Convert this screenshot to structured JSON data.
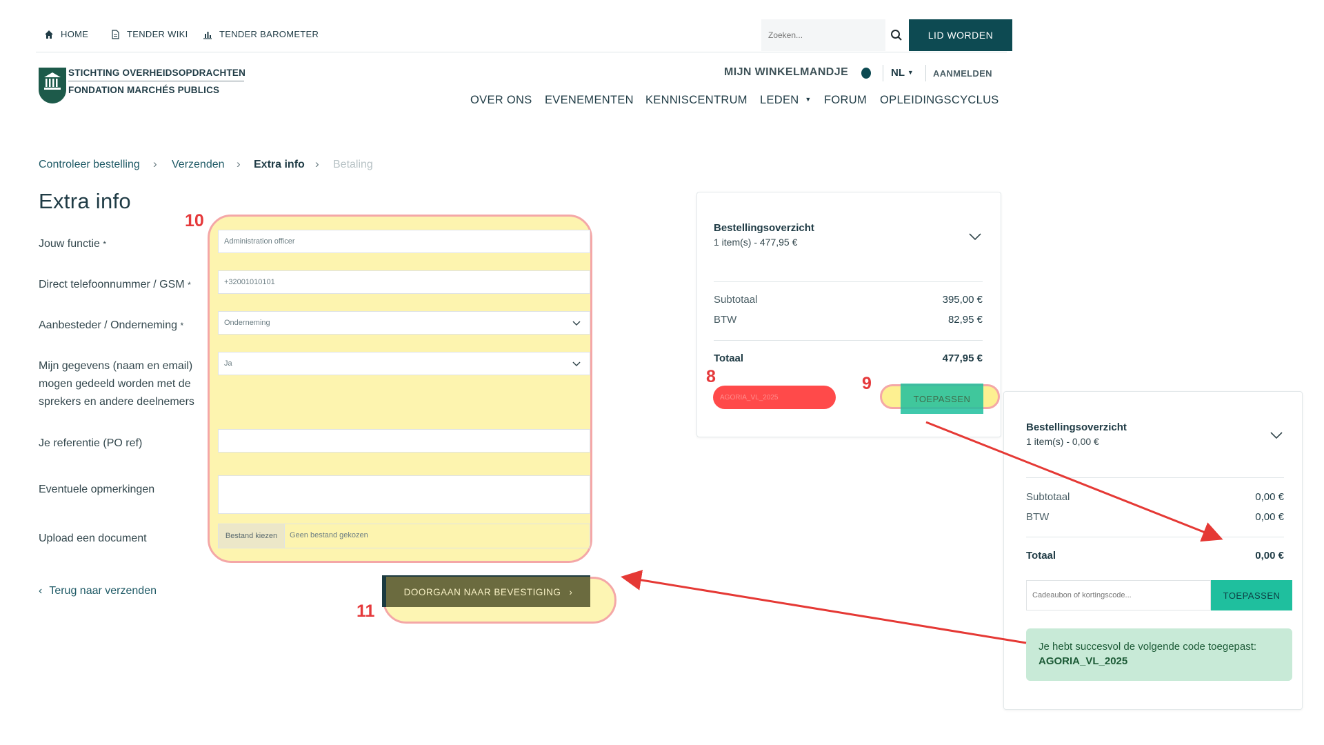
{
  "topbar": {
    "home": "HOME",
    "wiki": "TENDER WIKI",
    "barometer": "TENDER BAROMETER",
    "search_placeholder": "Zoeken...",
    "lid_worden": "LID WORDEN"
  },
  "logo": {
    "line1": "STICHTING OVERHEIDSOPDRACHTEN",
    "line2": "FONDATION MARCHÉS PUBLICS"
  },
  "header": {
    "cart": "MIJN WINKELMANDJE",
    "lang": "NL",
    "login": "AANMELDEN",
    "nav": [
      "OVER ONS",
      "EVENEMENTEN",
      "KENNISCENTRUM",
      "LEDEN",
      "FORUM",
      "OPLEIDINGSCYCLUS"
    ]
  },
  "breadcrumb": [
    "Controleer bestelling",
    "Verzenden",
    "Extra info",
    "Betaling"
  ],
  "page_title": "Extra info",
  "form": {
    "function_label": "Jouw functie",
    "function_value": "Administration officer",
    "phone_label": "Direct telefoonnummer / GSM",
    "phone_value": "+32001010101",
    "type_label": "Aanbesteder / Onderneming",
    "type_value": "Onderneming",
    "share_label": "Mijn gegevens (naam en email) mogen gedeeld worden met de sprekers en andere deelnemers",
    "share_value": "Ja",
    "ref_label": "Je referentie (PO ref)",
    "ref_value": "",
    "remarks_label": "Eventuele opmerkingen",
    "remarks_value": "",
    "upload_label": "Upload een document",
    "file_button": "Bestand kiezen",
    "file_none": "Geen bestand gekozen",
    "back": "Terug naar verzenden",
    "continue": "DOORGAAN NAAR BEVESTIGING"
  },
  "annotations": [
    "10",
    "8",
    "9",
    "11"
  ],
  "order1": {
    "title": "Bestellingsoverzicht",
    "items": "1 item(s) -  477,95 €",
    "subtotal_label": "Subtotaal",
    "subtotal": "395,00 €",
    "btw_label": "BTW",
    "btw": "82,95 €",
    "total_label": "Totaal",
    "total": "477,95 €",
    "code": "AGORIA_VL_2025",
    "apply": "TOEPASSEN"
  },
  "order2": {
    "title": "Bestellingsoverzicht",
    "items": "1 item(s) -  0,00 €",
    "subtotal_label": "Subtotaal",
    "subtotal": "0,00 €",
    "btw_label": "BTW",
    "btw": "0,00 €",
    "total_label": "Totaal",
    "total": "0,00 €",
    "coupon_placeholder": "Cadeaubon of kortingscode...",
    "apply": "TOEPASSEN",
    "success_text": "Je hebt succesvol de volgende code toegepast:",
    "success_code": "AGORIA_VL_2025"
  },
  "colors": {
    "teal": "#0d4a52",
    "green": "#1fbf9e",
    "annotation_red": "#e5393b",
    "highlight_yellow": "#fcec75"
  }
}
